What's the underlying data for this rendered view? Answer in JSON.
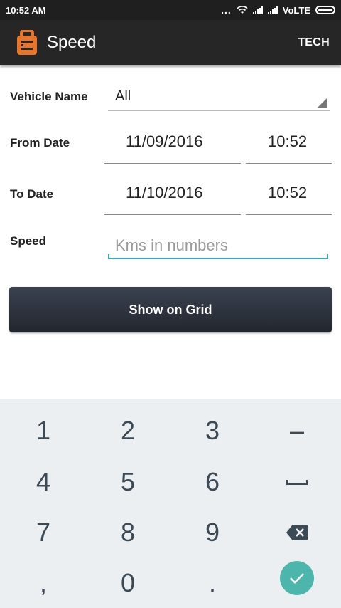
{
  "status_bar": {
    "time": "10:52 AM",
    "dots": "...",
    "network": "VoLTE"
  },
  "app_bar": {
    "title": "Speed",
    "action_label": "TECH"
  },
  "form": {
    "vehicle_label": "Vehicle Name",
    "vehicle_value": "All",
    "from_label": "From Date",
    "from_date": "11/09/2016",
    "from_time": "10:52",
    "to_label": "To Date",
    "to_date": "11/10/2016",
    "to_time": "10:52",
    "speed_label": "Speed",
    "speed_placeholder": "Kms in numbers",
    "speed_value": ""
  },
  "button": {
    "label": "Show on Grid"
  },
  "keyboard": {
    "keys": [
      "1",
      "2",
      "3",
      "–",
      "4",
      "5",
      "6",
      "",
      "7",
      "8",
      "9",
      "",
      ",",
      "0",
      ".",
      ""
    ]
  },
  "colors": {
    "app_bar": "#262626",
    "status_bar": "#1f1f1f",
    "accent": "#3aa9b8",
    "logo": "#e8752a",
    "done_key": "#4db6ac",
    "keyboard_bg": "#eceff1"
  },
  "icons": {
    "logo": "app-logo-icon",
    "space": "space-bar-icon",
    "backspace": "backspace-icon",
    "done": "checkmark-icon"
  }
}
